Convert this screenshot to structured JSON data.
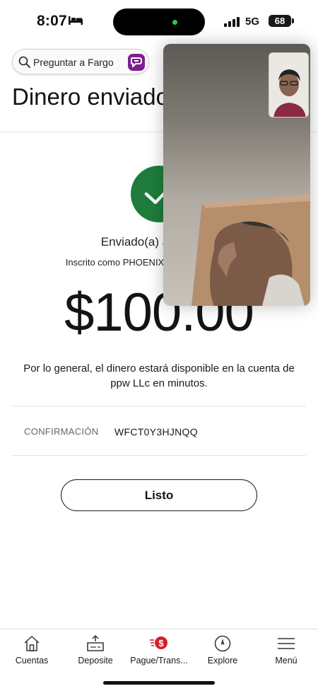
{
  "status_bar": {
    "time": "8:07",
    "network": "5G",
    "battery": "68"
  },
  "search": {
    "label": "Preguntar a Fargo"
  },
  "page": {
    "title": "Dinero enviado"
  },
  "confirmation_screen": {
    "sent_to": "Enviado(a) a ppw LLc",
    "enrolled_as": "Inscrito como PHOENIX PRIME WORKS LLC",
    "amount": "$100.00",
    "availability_note": "Por lo general, el dinero estará disponible en la cuenta de ppw LLc en minutos.",
    "confirmation_label": "CONFIRMACIÓN",
    "confirmation_code": "WFCT0Y3HJNQQ",
    "done_button": "Listo"
  },
  "tab_bar": {
    "items": [
      {
        "label": "Cuentas",
        "icon": "home-icon"
      },
      {
        "label": "Deposite",
        "icon": "deposit-icon"
      },
      {
        "label": "Pague/Trans...",
        "icon": "pay-transfer-icon"
      },
      {
        "label": "Explore",
        "icon": "compass-icon"
      },
      {
        "label": "Menú",
        "icon": "hamburger-menu-icon"
      }
    ]
  },
  "colors": {
    "success_green": "#1e7d3c",
    "fargo_purple": "#7c1f8f",
    "pay_red": "#d71e28"
  }
}
